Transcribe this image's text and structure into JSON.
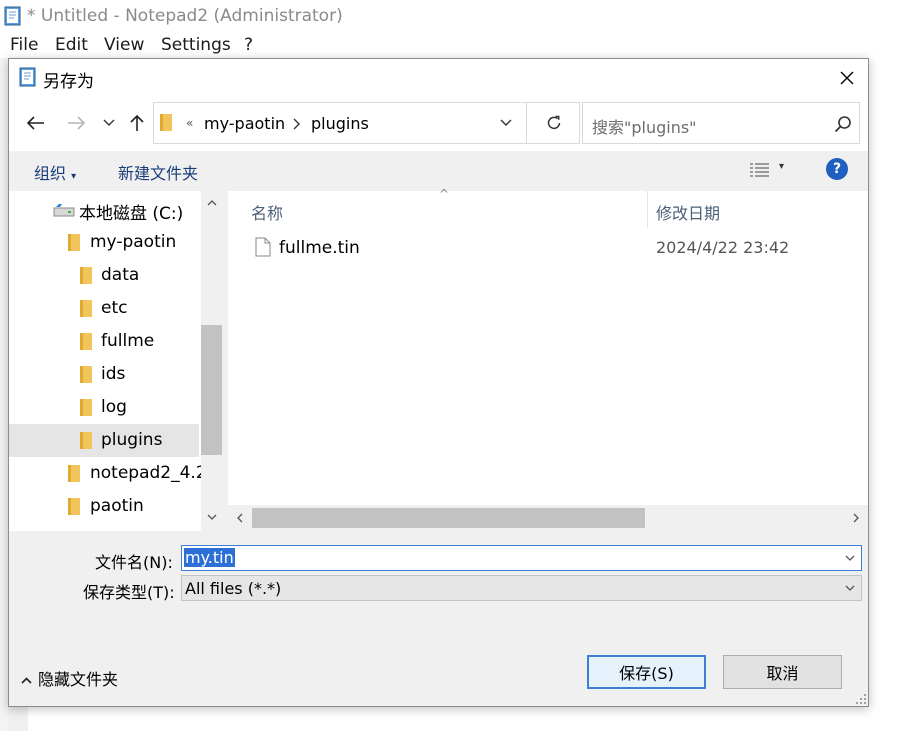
{
  "notepad": {
    "title": "* Untitled - Notepad2 (Administrator)",
    "menu": [
      "File",
      "Edit",
      "View",
      "Settings",
      "?"
    ]
  },
  "dialog": {
    "title": "另存为",
    "address": {
      "overflow": "«",
      "crumbs": [
        "my-paotin",
        "plugins"
      ]
    },
    "search_placeholder": "搜索\"plugins\"",
    "toolbar": {
      "organize": "组织",
      "new_folder": "新建文件夹",
      "help": "?"
    },
    "tree": [
      {
        "label": "本地磁盘 (C:)",
        "kind": "drive"
      },
      {
        "label": "my-paotin",
        "kind": "folder"
      },
      {
        "label": "data",
        "kind": "folder"
      },
      {
        "label": "etc",
        "kind": "folder"
      },
      {
        "label": "fullme",
        "kind": "folder"
      },
      {
        "label": "ids",
        "kind": "folder"
      },
      {
        "label": "log",
        "kind": "folder"
      },
      {
        "label": "plugins",
        "kind": "folder",
        "selected": true
      },
      {
        "label": "notepad2_4.2.",
        "kind": "folder"
      },
      {
        "label": "paotin",
        "kind": "folder"
      }
    ],
    "columns": {
      "name": "名称",
      "modified": "修改日期"
    },
    "files": [
      {
        "name": "fullme.tin",
        "modified": "2024/4/22 23:42"
      }
    ],
    "filename_label": "文件名(N):",
    "filename_value": "my.tin",
    "filetype_label": "保存类型(T):",
    "filetype_value": "All files (*.*)",
    "hide_folders": "隐藏文件夹",
    "save_button": "保存(S)",
    "cancel_button": "取消"
  }
}
